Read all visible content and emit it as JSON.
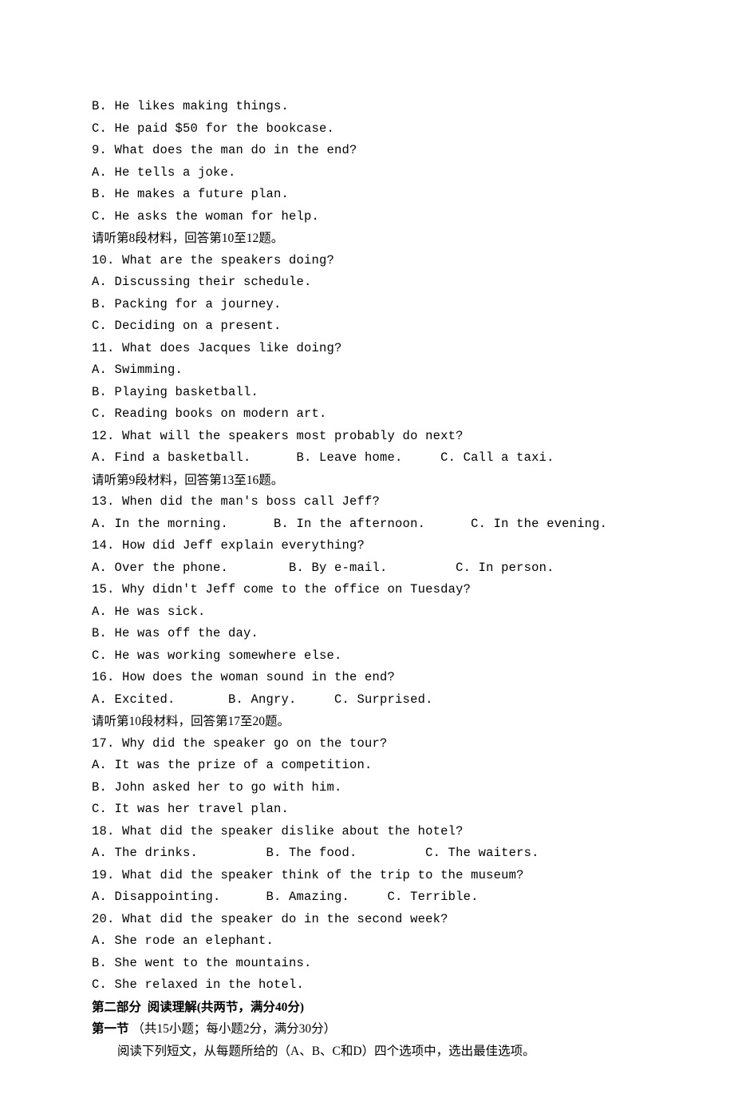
{
  "lines": [
    {
      "text": "B. He likes making things.",
      "mono": true
    },
    {
      "text": "C. He paid $50 for the bookcase.",
      "mono": true
    },
    {
      "text": "9. What does the man do in the end?",
      "mono": true
    },
    {
      "text": "A. He tells a joke.",
      "mono": true
    },
    {
      "text": "B. He makes a future plan.",
      "mono": true
    },
    {
      "text": "C. He asks the woman for help.",
      "mono": true
    },
    {
      "text": "请听第8段材料，回答第10至12题。"
    },
    {
      "text": "10. What are the speakers doing?",
      "mono": true
    },
    {
      "text": "A. Discussing their schedule.",
      "mono": true
    },
    {
      "text": "B. Packing for a journey.",
      "mono": true
    },
    {
      "text": "C. Deciding on a present.",
      "mono": true
    },
    {
      "text": "11. What does Jacques like doing?",
      "mono": true
    },
    {
      "text": "A. Swimming.",
      "mono": true
    },
    {
      "text": "B. Playing basketball.",
      "mono": true
    },
    {
      "text": "C. Reading books on modern art.",
      "mono": true
    },
    {
      "text": "12. What will the speakers most probably do next?",
      "mono": true
    },
    {
      "text": "A. Find a basketball.      B. Leave home.     C. Call a taxi.",
      "mono": true
    },
    {
      "text": "请听第9段材料，回答第13至16题。"
    },
    {
      "text": "13. When did the man's boss call Jeff?",
      "mono": true
    },
    {
      "text": "A. In the morning.      B. In the afternoon.      C. In the evening.",
      "mono": true
    },
    {
      "text": "14. How did Jeff explain everything?",
      "mono": true
    },
    {
      "text": "A. Over the phone.        B. By e-mail.         C. In person.",
      "mono": true
    },
    {
      "text": "15. Why didn't Jeff come to the office on Tuesday?",
      "mono": true
    },
    {
      "text": "A. He was sick.",
      "mono": true
    },
    {
      "text": "B. He was off the day.",
      "mono": true
    },
    {
      "text": "C. He was working somewhere else.",
      "mono": true
    },
    {
      "text": "16. How does the woman sound in the end?",
      "mono": true
    },
    {
      "text": "A. Excited.       B. Angry.     C. Surprised.",
      "mono": true
    },
    {
      "text": "请听第10段材料，回答第17至20题。"
    },
    {
      "text": "17. Why did the speaker go on the tour?",
      "mono": true
    },
    {
      "text": "A. It was the prize of a competition.",
      "mono": true
    },
    {
      "text": "B. John asked her to go with him.",
      "mono": true
    },
    {
      "text": "C. It was her travel plan.",
      "mono": true
    },
    {
      "text": "18. What did the speaker dislike about the hotel?",
      "mono": true
    },
    {
      "text": "A. The drinks.         B. The food.         C. The waiters.",
      "mono": true
    },
    {
      "text": "19. What did the speaker think of the trip to the museum?",
      "mono": true
    },
    {
      "text": "A. Disappointing.      B. Amazing.     C. Terrible.",
      "mono": true
    },
    {
      "text": "20. What did the speaker do in the second week?",
      "mono": true
    },
    {
      "text": "A. She rode an elephant.",
      "mono": true
    },
    {
      "text": "B. She went to the mountains.",
      "mono": true
    },
    {
      "text": "C. She relaxed in the hotel.",
      "mono": true
    },
    {
      "text": "第二部分  阅读理解(共两节，满分40分)",
      "bold": true
    },
    {
      "text": "第一节 ",
      "bold": true,
      "inline_suffix": "（共15小题；每小题2分，满分30分）"
    },
    {
      "text": "阅读下列短文，从每题所给的（A、B、C和D）四个选项中，选出最佳选项。",
      "indent": true
    }
  ]
}
